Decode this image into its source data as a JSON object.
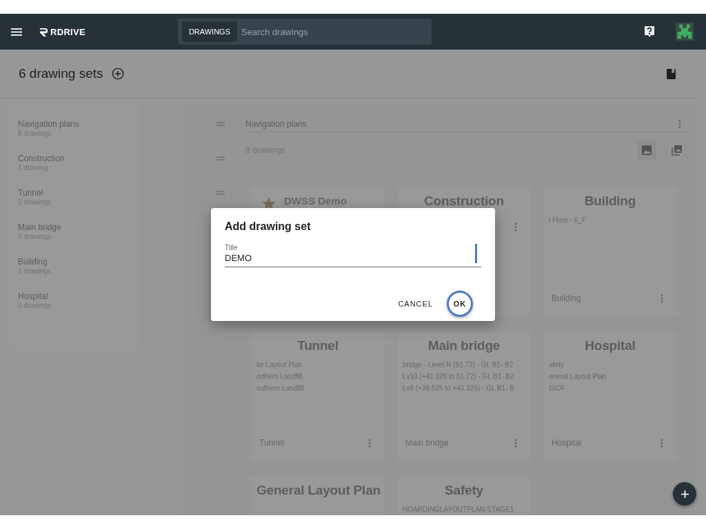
{
  "app_bar": {
    "logo": "RDRIVE",
    "search_scope": "DRAWINGS",
    "search_placeholder": "Search drawings"
  },
  "page": {
    "title": "6 drawing sets"
  },
  "sidebar": {
    "items": [
      {
        "title": "Navigation plans",
        "count": "8 drawings"
      },
      {
        "title": "Construction",
        "count": "1 drawing"
      },
      {
        "title": "Tunnel",
        "count": "3 drawings"
      },
      {
        "title": "Main bridge",
        "count": "3 drawings"
      },
      {
        "title": "Building",
        "count": "1 drawings"
      },
      {
        "title": "Hospital",
        "count": "3 drawings"
      }
    ]
  },
  "detail": {
    "set_title": "Navigation plans",
    "count": "8 drawings"
  },
  "cards": [
    {
      "kind": "favorite",
      "title": "DWSS Demo"
    },
    {
      "kind": "set",
      "title": "Construction"
    },
    {
      "kind": "set",
      "title": "Building",
      "lines": [
        "l Floor - 6_F"
      ],
      "footer": "Building"
    },
    {
      "kind": "set",
      "title": "Tunnel",
      "lines": [
        "ite Layout Plan",
        "orthern Landfill",
        "outhern Landfill"
      ],
      "footer": "Tunnel"
    },
    {
      "kind": "set",
      "title": "Main bridge",
      "lines": [
        "bridge - Level R (51.72) - GL B1- B2",
        "Lv10 (+41.325 to 51.72) - GL B1- B2",
        "Lv9 (+38.525 to +41.325) - GL B1- B"
      ],
      "footer": "Main bridge"
    },
    {
      "kind": "set",
      "title": "Hospital",
      "lines": [
        "afety",
        "eneral Layout Plan",
        "ISCF"
      ],
      "footer": "Hospital"
    },
    {
      "kind": "set",
      "title": "General Layout Plan"
    },
    {
      "kind": "set",
      "title": "Safety",
      "lines": [
        "HOARDINGLAYOUTPLAN-STAGE1"
      ]
    }
  ],
  "dialog": {
    "title": "Add drawing set",
    "field": {
      "label": "Title",
      "value": "DEMO"
    },
    "buttons": [
      {
        "label": "CANCEL",
        "kind": "text"
      },
      {
        "label": "OK",
        "kind": "focused"
      }
    ]
  }
}
